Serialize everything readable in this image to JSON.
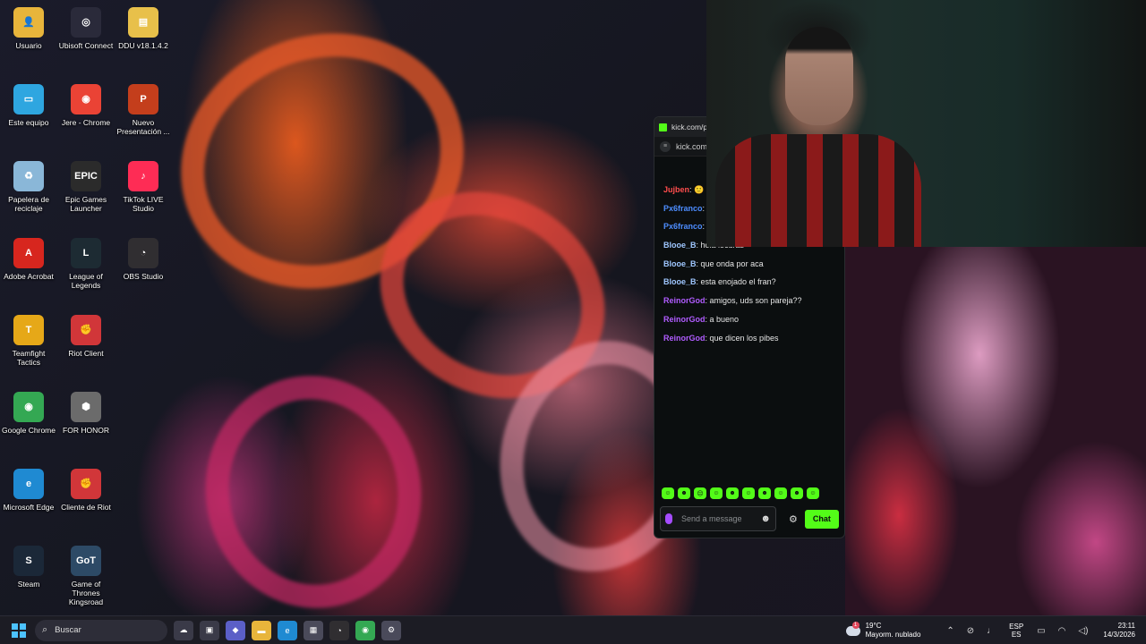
{
  "desktop": {
    "icons": [
      {
        "label": "Usuario",
        "glyph": "👤",
        "color": "#e8b53b"
      },
      {
        "label": "Ubisoft Connect",
        "glyph": "◎",
        "color": "#2a2a3a"
      },
      {
        "label": "DDU v18.1.4.2",
        "glyph": "▤",
        "color": "#e8c04a"
      },
      {
        "label": "Este equipo",
        "glyph": "▭",
        "color": "#2ea6e0"
      },
      {
        "label": "Jere - Chrome",
        "glyph": "◉",
        "color": "#ea4335"
      },
      {
        "label": "Nuevo Presentación ...",
        "glyph": "P",
        "color": "#c43e1c"
      },
      {
        "label": "Papelera de reciclaje",
        "glyph": "♻",
        "color": "#8ab7d8"
      },
      {
        "label": "Epic Games Launcher",
        "glyph": "EPIC",
        "color": "#2b2b2b"
      },
      {
        "label": "TikTok LIVE Studio",
        "glyph": "♪",
        "color": "#fe2c55"
      },
      {
        "label": "Adobe Acrobat",
        "glyph": "A",
        "color": "#d7261e"
      },
      {
        "label": "League of Legends",
        "glyph": "L",
        "color": "#1d2b33"
      },
      {
        "label": "OBS Studio",
        "glyph": "◔",
        "color": "#302e31"
      },
      {
        "label": "Teamfight Tactics",
        "glyph": "T",
        "color": "#e6a818"
      },
      {
        "label": "Riot Client",
        "glyph": "✊",
        "color": "#d13639"
      },
      {
        "label": "Google Chrome",
        "glyph": "◉",
        "color": "#34a853"
      },
      {
        "label": "FOR HONOR",
        "glyph": "⬢",
        "color": "#6b6b6b"
      },
      {
        "label": "Microsoft Edge",
        "glyph": "e",
        "color": "#1f8ad2"
      },
      {
        "label": "Cliente de Riot",
        "glyph": "✊",
        "color": "#d13639"
      },
      {
        "label": "Steam",
        "glyph": "S",
        "color": "#1b2838"
      },
      {
        "label": "Game of Thrones Kingsroad",
        "glyph": "GoT",
        "color": "#2d4a66"
      }
    ]
  },
  "chat": {
    "tab_title": "kick.com/pc",
    "url": "kick.com",
    "messages": [
      {
        "user": "Jujben",
        "text": ": 🙂",
        "color": "#ff4d4d"
      },
      {
        "user": "Px6franco",
        "text": ":",
        "color": "#4d8dff"
      },
      {
        "user": "Px6franco",
        "text": ":",
        "color": "#4d8dff"
      },
      {
        "user": "Blooe_B",
        "text": ": hola locuras",
        "color": "#9fc7ff"
      },
      {
        "user": "Blooe_B",
        "text": ": que onda por aca",
        "color": "#9fc7ff"
      },
      {
        "user": "Blooe_B",
        "text": ": esta enojado el fran?",
        "color": "#9fc7ff"
      },
      {
        "user": "ReinorGod",
        "text": ": amigos, uds son pareja??",
        "color": "#b05cff"
      },
      {
        "user": "ReinorGod",
        "text": ": a bueno",
        "color": "#b05cff"
      },
      {
        "user": "ReinorGod",
        "text": ": que dicen los pibes",
        "color": "#b05cff"
      }
    ],
    "emotes": [
      "☺",
      "☻",
      "☹",
      "☺",
      "☻",
      "☺",
      "☻",
      "☺",
      "☻",
      "☺"
    ],
    "input_placeholder": "Send a message",
    "send_label": "Chat",
    "accent": "#53fc18"
  },
  "taskbar": {
    "search_label": "Buscar",
    "apps": [
      {
        "name": "widgets",
        "glyph": "☁",
        "color": "#3a3a48"
      },
      {
        "name": "task-view",
        "glyph": "▣",
        "color": "#3a3a48"
      },
      {
        "name": "ms365",
        "glyph": "◆",
        "color": "#5b5fc7"
      },
      {
        "name": "file-explorer",
        "glyph": "▬",
        "color": "#e8b53b"
      },
      {
        "name": "edge",
        "glyph": "e",
        "color": "#1f8ad2"
      },
      {
        "name": "store",
        "glyph": "▦",
        "color": "#4a4a5a"
      },
      {
        "name": "obs",
        "glyph": "◔",
        "color": "#302e31"
      },
      {
        "name": "chrome",
        "glyph": "◉",
        "color": "#34a853"
      },
      {
        "name": "settings",
        "glyph": "⚙",
        "color": "#4a4a5a"
      }
    ],
    "weather": {
      "badge": "1",
      "temp": "19°C",
      "desc": "Mayorm. nublado"
    },
    "lang": {
      "top": "ESP",
      "bottom": "ES"
    },
    "time": "23:11",
    "date": "14/3/2026"
  }
}
